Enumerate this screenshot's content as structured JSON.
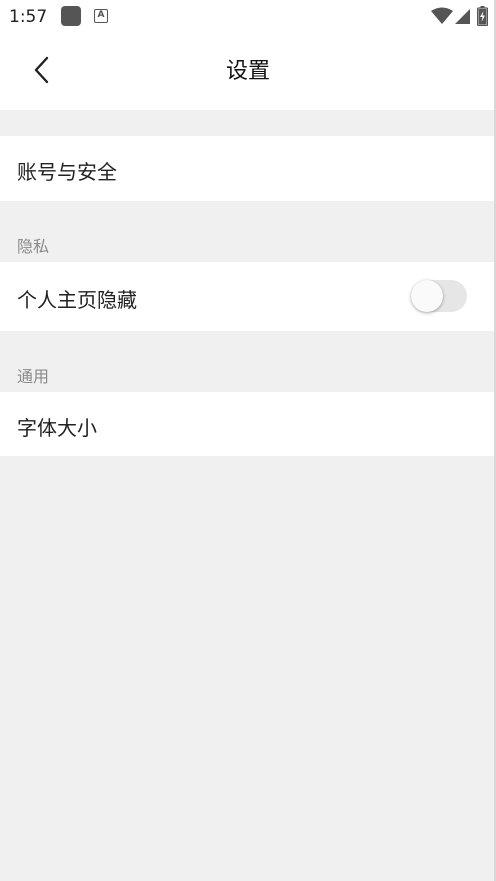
{
  "status_bar": {
    "time": "1:57",
    "notification_icon_2_letter": "A",
    "icons": [
      "app-notification-icon",
      "font-notification-icon",
      "wifi-icon",
      "signal-icon",
      "battery-charging-icon"
    ]
  },
  "header": {
    "title": "设置",
    "back_icon": "chevron-left-icon"
  },
  "sections": [
    {
      "items": [
        {
          "label": "账号与安全"
        }
      ]
    },
    {
      "title": "隐私",
      "items": [
        {
          "label": "个人主页隐藏",
          "toggle": false
        }
      ]
    },
    {
      "title": "通用",
      "items": [
        {
          "label": "字体大小"
        }
      ]
    }
  ],
  "colors": {
    "background": "#f0f0f0",
    "surface": "#ffffff",
    "toggle_track_off": "#e6e6e6"
  }
}
